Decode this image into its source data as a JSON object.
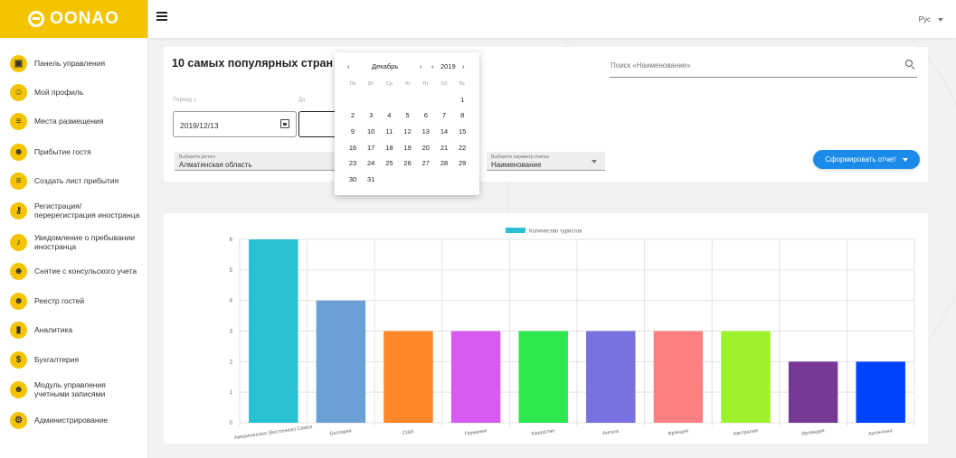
{
  "logo": {
    "text": "OONAO"
  },
  "sidebar": {
    "items": [
      {
        "label": "Панель управления",
        "icon": "monitor-icon",
        "glyph": "▣"
      },
      {
        "label": "Мой профиль",
        "icon": "person-icon",
        "glyph": "☺"
      },
      {
        "label": "Места размещения",
        "icon": "list-check-icon",
        "glyph": "≡"
      },
      {
        "label": "Прибытие гостя",
        "icon": "person-arrive-icon",
        "glyph": "☻"
      },
      {
        "label": "Создать лист прибытия",
        "icon": "playlist-add-icon",
        "glyph": "≡"
      },
      {
        "label": "Регистрация/\nперерегистрация иностранца",
        "icon": "key-icon",
        "glyph": "⚷"
      },
      {
        "label": "Уведомление о пребывании\nиностранца",
        "icon": "bell-icon",
        "glyph": "♪"
      },
      {
        "label": "Снятие с консульского учета",
        "icon": "person-remove-icon",
        "glyph": "☻"
      },
      {
        "label": "Реестр гостей",
        "icon": "people-icon",
        "glyph": "☻"
      },
      {
        "label": "Аналитика",
        "icon": "bar-chart-icon",
        "glyph": "▮"
      },
      {
        "label": "Бухгалтерия",
        "icon": "dollar-icon",
        "glyph": "$"
      },
      {
        "label": "Модуль управления\nучетными записями",
        "icon": "group-icon",
        "glyph": "☻"
      },
      {
        "label": "Администрирование",
        "icon": "gear-icon",
        "glyph": "⚙"
      }
    ]
  },
  "topbar": {
    "language": "Рус"
  },
  "report": {
    "title": "10 самых популярных стран",
    "period_label": "Период с",
    "to_label": "До",
    "date_from": "2019/12/13",
    "region": {
      "caption": "Выберите регион",
      "value": "Алматинская область"
    },
    "param": {
      "caption": "Выберите параметр поиска",
      "value": "Наименование"
    },
    "search_placeholder": "Поиск «Наименование»",
    "generate_label": "Сформировать отчет"
  },
  "calendar": {
    "month": "Декабрь",
    "year": "2019",
    "weekdays": [
      "Пн",
      "Вт",
      "Ср",
      "Чт",
      "Пт",
      "Сб",
      "Вс"
    ],
    "days": [
      "1",
      "2",
      "3",
      "4",
      "5",
      "6",
      "7",
      "8",
      "9",
      "10",
      "11",
      "12",
      "13",
      "14",
      "15",
      "16",
      "17",
      "18",
      "19",
      "20",
      "21",
      "22",
      "23",
      "24",
      "25",
      "26",
      "27",
      "28",
      "29",
      "30",
      "31"
    ],
    "first_weekday_index": 6
  },
  "chart_data": {
    "type": "bar",
    "categories": [
      "Американское (Восточное) Самоа",
      "Болгария",
      "США",
      "Германия",
      "Казахстан",
      "Ангола",
      "Франция",
      "Австралия",
      "Ирландия",
      "Аргентина"
    ],
    "series": [
      {
        "name": "Количество туристов",
        "values": [
          6,
          4,
          3,
          3,
          3,
          3,
          3,
          3,
          2,
          2
        ]
      }
    ],
    "colors": [
      "#29c0d3",
      "#6b9fd6",
      "#ff8727",
      "#d95af0",
      "#2ee84e",
      "#7772e0",
      "#ff8080",
      "#9ef22d",
      "#763a96",
      "#0043ff"
    ],
    "legend_color": "#29c0d3",
    "ylim": [
      0,
      6
    ],
    "yticks": [
      0,
      1,
      2,
      3,
      4,
      5,
      6
    ],
    "grid": true,
    "legend_position": "top"
  }
}
